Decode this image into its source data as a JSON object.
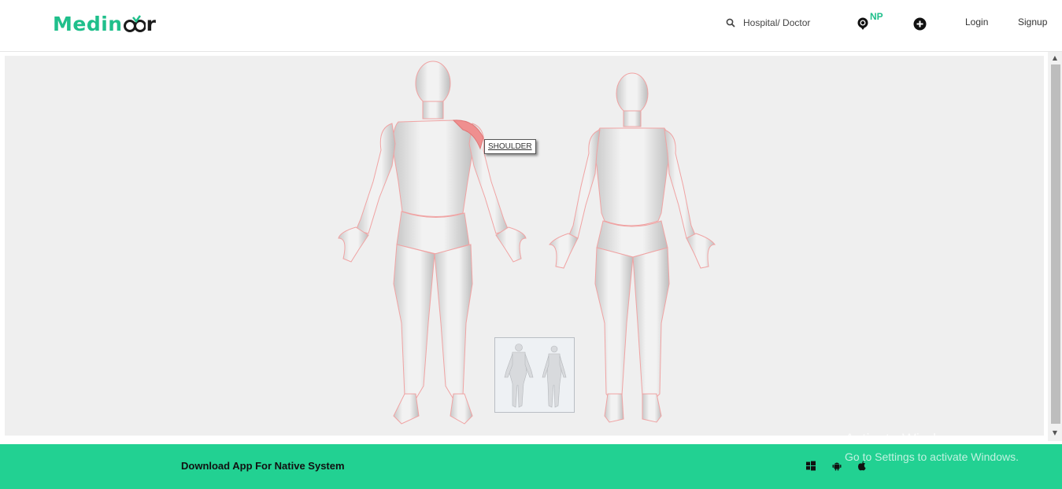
{
  "header": {
    "logo": {
      "prefix": "Medin",
      "suffix": "r",
      "brand_color": "#1fbf8b"
    },
    "search": {
      "icon": "search-icon",
      "label": "Hospital/ Doctor"
    },
    "location": {
      "icon": "location-pin-icon",
      "badge": "NP"
    },
    "add": {
      "icon": "plus-circle-icon"
    },
    "nav": {
      "login": "Login",
      "signup": "Signup"
    }
  },
  "body_map": {
    "tooltip": "SHOULDER",
    "highlight_color": "#ef8f8f",
    "outline_color": "#f0a3a3",
    "views": [
      "male-front",
      "female-front"
    ],
    "thumbnail": "back-view-thumbnail"
  },
  "footer": {
    "download_text": "Download App For Native System",
    "platform_icons": [
      "windows-icon",
      "android-icon",
      "apple-icon"
    ],
    "background": "#22d192"
  },
  "watermark": {
    "line1": "Activate Windows",
    "line2": "Go to Settings to activate Windows."
  }
}
